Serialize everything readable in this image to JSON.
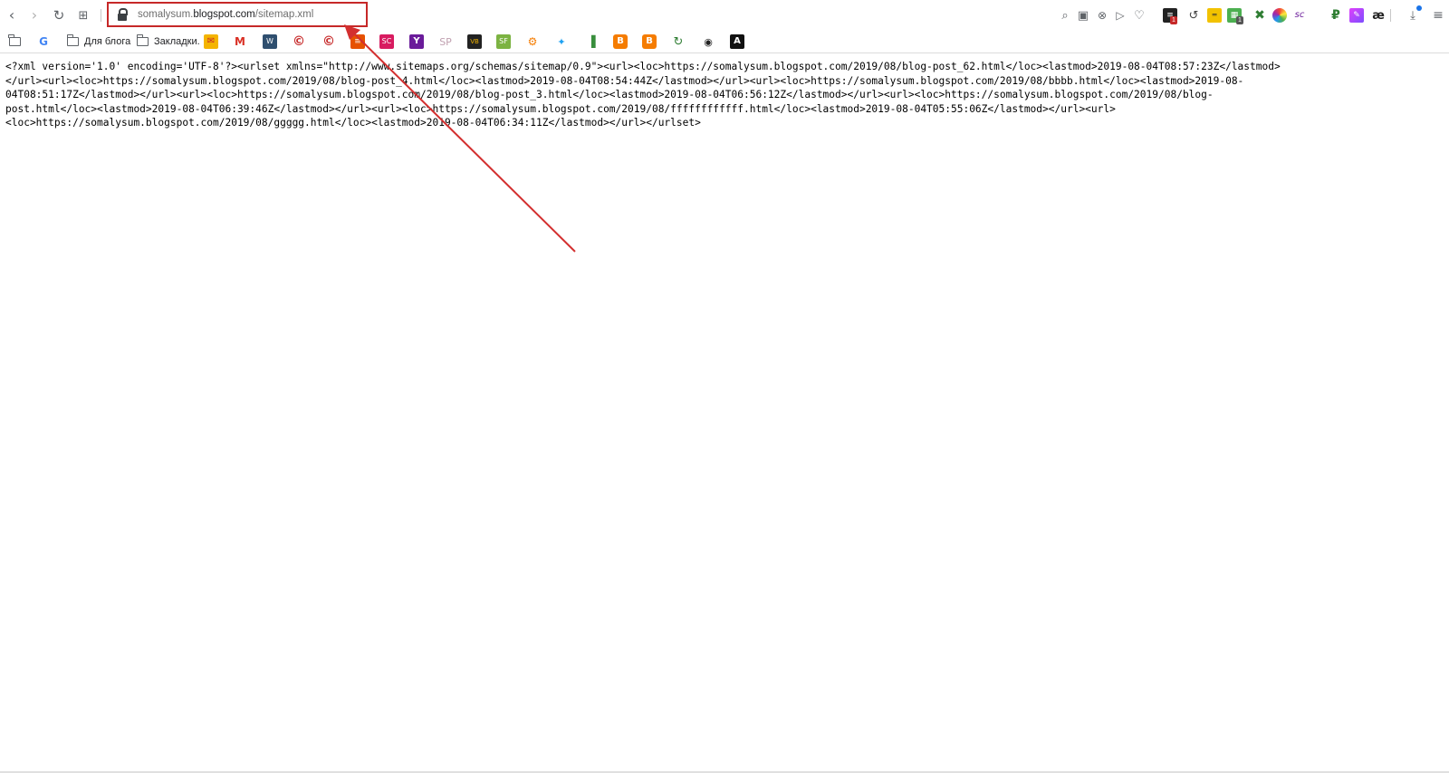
{
  "browser": {
    "address_bar": {
      "url_prefix": "somalysum.",
      "url_host": "blogspot.com",
      "url_path": "/sitemap.xml"
    },
    "nav_icons": [
      "back-icon",
      "forward-icon",
      "reload-icon",
      "tabs-grid-icon"
    ],
    "right_icons": [
      "zoom-icon",
      "camera-icon",
      "shield-icon",
      "send-icon",
      "heart-icon"
    ],
    "extension_badges": {
      "first": "1",
      "second": "1"
    },
    "accent_color": "#c62828"
  },
  "bookmarks": {
    "folders": [
      "Для блога",
      "Закладки."
    ],
    "icons": [
      "mail-icon",
      "gmail-icon",
      "wp-icon",
      "copyright-icon",
      "copyright-icon",
      "rss-icon",
      "sc-icon",
      "yahoo-icon",
      "sp-icon",
      "vb-icon",
      "sf-icon",
      "gear-icon",
      "twitter-icon",
      "chart-icon",
      "blogger-icon",
      "blogger-icon",
      "refresh-icon",
      "panda-icon",
      "font-icon"
    ]
  },
  "document": {
    "lines": [
      "<?xml version='1.0' encoding='UTF-8'?><urlset xmlns=\"http://www.sitemaps.org/schemas/sitemap/0.9\"><url><loc>https://somalysum.blogspot.com/2019/08/blog-post_62.html</loc><lastmod>2019-08-04T08:57:23Z</lastmod>",
      "</url><url><loc>https://somalysum.blogspot.com/2019/08/blog-post_4.html</loc><lastmod>2019-08-04T08:54:44Z</lastmod></url><url><loc>https://somalysum.blogspot.com/2019/08/bbbb.html</loc><lastmod>2019-08-",
      "04T08:51:17Z</lastmod></url><url><loc>https://somalysum.blogspot.com/2019/08/blog-post_3.html</loc><lastmod>2019-08-04T06:56:12Z</lastmod></url><url><loc>https://somalysum.blogspot.com/2019/08/blog-",
      "post.html</loc><lastmod>2019-08-04T06:39:46Z</lastmod></url><url><loc>https://somalysum.blogspot.com/2019/08/ffffffffffff.html</loc><lastmod>2019-08-04T05:55:06Z</lastmod></url><url>",
      "<loc>https://somalysum.blogspot.com/2019/08/ggggg.html</loc><lastmod>2019-08-04T06:34:11Z</lastmod></url></urlset>"
    ]
  }
}
